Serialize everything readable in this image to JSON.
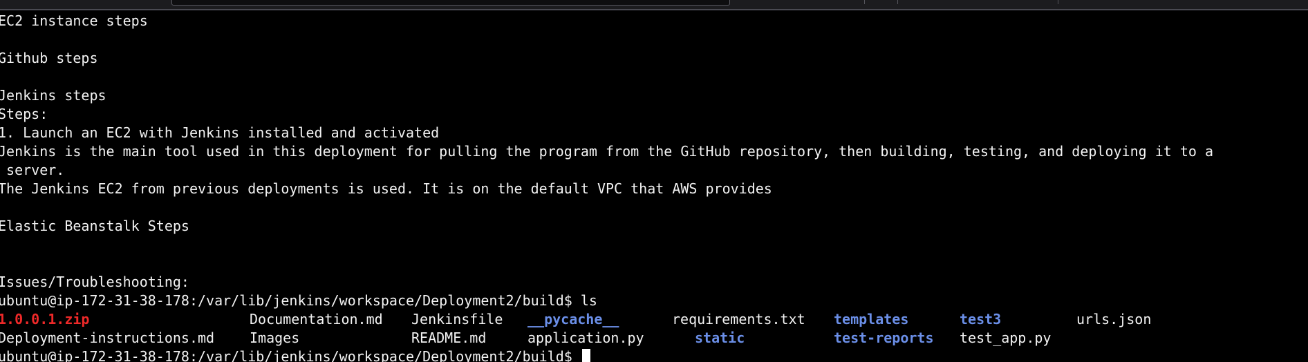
{
  "terminal": {
    "lines": [
      "EC2 instance steps",
      "Github steps",
      "Jenkins steps",
      "Steps:",
      "1. Launch an EC2 with Jenkins installed and activated",
      "Jenkins is the main tool used in this deployment for pulling the program from the GitHub repository, then building, testing, and deploying it to a",
      " server.",
      "The Jenkins EC2 from previous deployments is used. It is on the default VPC that AWS provides",
      "Elastic Beanstalk Steps",
      "Issues/Troubleshooting:"
    ],
    "prompt": "ubuntu@ip-172-31-38-178:/var/lib/jenkins/workspace/Deployment2/build$",
    "command": "ls",
    "ls_row1": [
      "1.0.0.1.zip",
      "Documentation.md",
      "Jenkinsfile",
      "__pycache__",
      "requirements.txt",
      "templates",
      "test3",
      "urls.json"
    ],
    "ls_row2": [
      "Deployment-instructions.md",
      "Images",
      "README.md",
      "application.py",
      "static",
      "test-reports",
      "test_app.py"
    ]
  },
  "colors": {
    "background": "#000000",
    "text": "#f2f2f2",
    "archive": "#ef2929",
    "directory": "#6b8fe8"
  }
}
